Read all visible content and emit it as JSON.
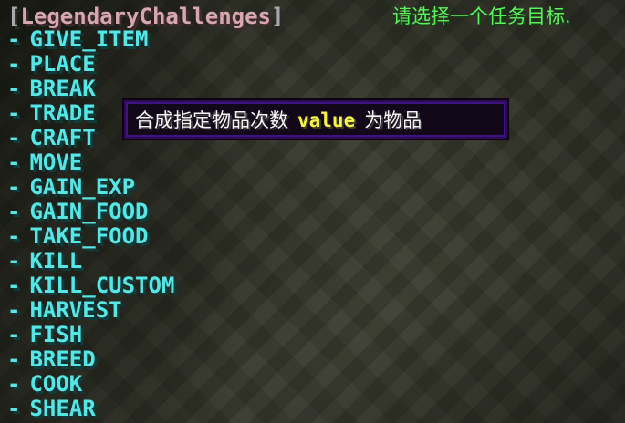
{
  "header": {
    "bracket_open": "[",
    "plugin_name": "LegendaryChallenges",
    "bracket_close": "]",
    "prompt": "请选择一个任务目标.",
    "colors": {
      "plugin_name": "#d6a7b0",
      "bracket": "#a9a9a9",
      "prompt": "#5cf25c"
    }
  },
  "options": {
    "dash": "-",
    "color": "#57e6e6",
    "items": [
      "GIVE_ITEM",
      "PLACE",
      "BREAK",
      "TRADE",
      "CRAFT",
      "MOVE",
      "GAIN_EXP",
      "GAIN_FOOD",
      "TAKE_FOOD",
      "KILL",
      "KILL_CUSTOM",
      "HARVEST",
      "FISH",
      "BREED",
      "COOK",
      "SHEAR"
    ]
  },
  "tooltip": {
    "hovered_option": "CRAFT",
    "text_before": "合成指定物品次数",
    "highlight": "value",
    "text_after": "为物品",
    "colors": {
      "text": "#f5f5f5",
      "highlight": "#f6f24a",
      "background": "#12081a",
      "border": "#2a0c56"
    }
  }
}
